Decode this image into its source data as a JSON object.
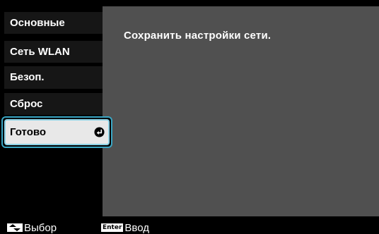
{
  "menu": {
    "items": [
      {
        "label": "Основные"
      },
      {
        "label": "Сеть WLAN"
      },
      {
        "label": "Безоп."
      },
      {
        "label": "Сброс"
      },
      {
        "label": "Готово",
        "selected": true,
        "icon": "enter-icon"
      }
    ]
  },
  "content": {
    "message": "Сохранить настройки сети."
  },
  "footer": {
    "select": {
      "key_icon": "up-down-arrows-icon",
      "label": "Выбор"
    },
    "enter": {
      "key_label": "Enter",
      "label": "Ввод"
    }
  },
  "colors": {
    "panel": "#505050",
    "tab": "#161616",
    "highlight_border": "#3aa6c4",
    "selected_bg": "#e8e8e8"
  }
}
